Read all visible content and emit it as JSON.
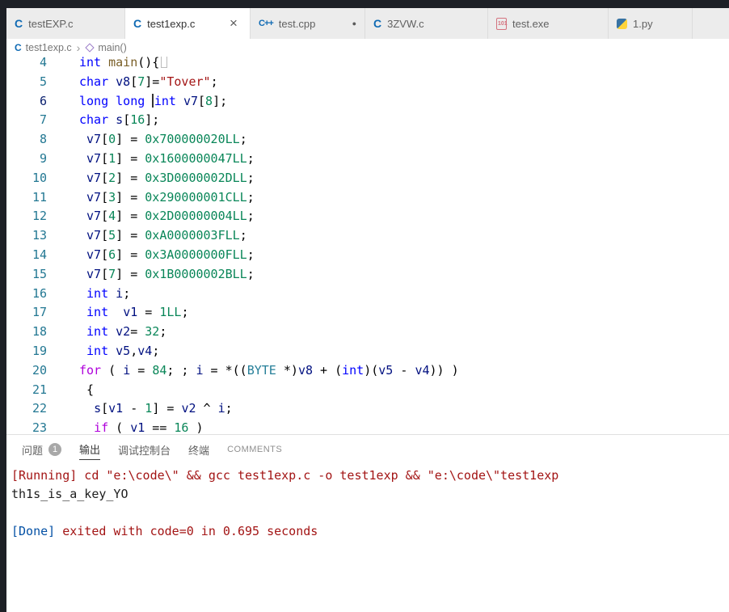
{
  "colors": {
    "keyword": "#0000ff",
    "control": "#af00db",
    "number": "#098658",
    "string": "#a31515",
    "variable": "#001080",
    "type": "#267f99",
    "function": "#795e26",
    "line_number": "#237893",
    "output_red": "#a31515",
    "output_blue": "#0451a5",
    "dark_strip": "#1d2026",
    "tab_inactive_bg": "#ececec",
    "tab_active_bg": "#ffffff"
  },
  "tabs": [
    {
      "label": "testEXP.c",
      "icon": "c",
      "active": false,
      "modified": false,
      "closable": false
    },
    {
      "label": "test1exp.c",
      "icon": "c",
      "active": true,
      "modified": false,
      "closable": true
    },
    {
      "label": "test.cpp",
      "icon": "cpp",
      "active": false,
      "modified": true,
      "closable": false
    },
    {
      "label": "3ZVW.c",
      "icon": "c",
      "active": false,
      "modified": false,
      "closable": false
    },
    {
      "label": "test.exe",
      "icon": "exe",
      "active": false,
      "modified": false,
      "closable": false
    },
    {
      "label": "1.py",
      "icon": "py",
      "active": false,
      "modified": false,
      "closable": false
    }
  ],
  "breadcrumb": {
    "file": "test1exp.c",
    "separator": "›",
    "symbol": "main()"
  },
  "editor": {
    "cursor_line": 6,
    "lines": [
      {
        "num": 4,
        "tokens": [
          [
            "int",
            "kw"
          ],
          [
            " ",
            "pl"
          ],
          [
            "main",
            "fn"
          ],
          [
            "(){",
            "pl"
          ],
          [
            "",
            "box"
          ]
        ]
      },
      {
        "num": 5,
        "tokens": [
          [
            "char",
            "kw"
          ],
          [
            " ",
            "pl"
          ],
          [
            "v8",
            "var"
          ],
          [
            "[",
            "pl"
          ],
          [
            "7",
            "num"
          ],
          [
            "]=",
            "pl"
          ],
          [
            "\"Tover\"",
            "str"
          ],
          [
            ";",
            "pl"
          ]
        ]
      },
      {
        "num": 6,
        "tokens": [
          [
            "long",
            "kw"
          ],
          [
            " ",
            "pl"
          ],
          [
            "long",
            "kw"
          ],
          [
            " ",
            "pl"
          ],
          [
            "",
            "cur"
          ],
          [
            "int",
            "kw"
          ],
          [
            " ",
            "pl"
          ],
          [
            "v7",
            "var"
          ],
          [
            "[",
            "pl"
          ],
          [
            "8",
            "num"
          ],
          [
            "];",
            "pl"
          ]
        ]
      },
      {
        "num": 7,
        "tokens": [
          [
            "char",
            "kw"
          ],
          [
            " ",
            "pl"
          ],
          [
            "s",
            "var"
          ],
          [
            "[",
            "pl"
          ],
          [
            "16",
            "num"
          ],
          [
            "];",
            "pl"
          ]
        ]
      },
      {
        "num": 8,
        "tokens": [
          [
            " ",
            "pl"
          ],
          [
            "v7",
            "var"
          ],
          [
            "[",
            "pl"
          ],
          [
            "0",
            "num"
          ],
          [
            "] = ",
            "pl"
          ],
          [
            "0x700000020LL",
            "num"
          ],
          [
            ";",
            "pl"
          ]
        ]
      },
      {
        "num": 9,
        "tokens": [
          [
            " ",
            "pl"
          ],
          [
            "v7",
            "var"
          ],
          [
            "[",
            "pl"
          ],
          [
            "1",
            "num"
          ],
          [
            "] = ",
            "pl"
          ],
          [
            "0x1600000047LL",
            "num"
          ],
          [
            ";",
            "pl"
          ]
        ]
      },
      {
        "num": 10,
        "tokens": [
          [
            " ",
            "pl"
          ],
          [
            "v7",
            "var"
          ],
          [
            "[",
            "pl"
          ],
          [
            "2",
            "num"
          ],
          [
            "] = ",
            "pl"
          ],
          [
            "0x3D0000002DLL",
            "num"
          ],
          [
            ";",
            "pl"
          ]
        ]
      },
      {
        "num": 11,
        "tokens": [
          [
            " ",
            "pl"
          ],
          [
            "v7",
            "var"
          ],
          [
            "[",
            "pl"
          ],
          [
            "3",
            "num"
          ],
          [
            "] = ",
            "pl"
          ],
          [
            "0x290000001CLL",
            "num"
          ],
          [
            ";",
            "pl"
          ]
        ]
      },
      {
        "num": 12,
        "tokens": [
          [
            " ",
            "pl"
          ],
          [
            "v7",
            "var"
          ],
          [
            "[",
            "pl"
          ],
          [
            "4",
            "num"
          ],
          [
            "] = ",
            "pl"
          ],
          [
            "0x2D00000004LL",
            "num"
          ],
          [
            ";",
            "pl"
          ]
        ]
      },
      {
        "num": 13,
        "tokens": [
          [
            " ",
            "pl"
          ],
          [
            "v7",
            "var"
          ],
          [
            "[",
            "pl"
          ],
          [
            "5",
            "num"
          ],
          [
            "] = ",
            "pl"
          ],
          [
            "0xA0000003FLL",
            "num"
          ],
          [
            ";",
            "pl"
          ]
        ]
      },
      {
        "num": 14,
        "tokens": [
          [
            " ",
            "pl"
          ],
          [
            "v7",
            "var"
          ],
          [
            "[",
            "pl"
          ],
          [
            "6",
            "num"
          ],
          [
            "] = ",
            "pl"
          ],
          [
            "0x3A0000000FLL",
            "num"
          ],
          [
            ";",
            "pl"
          ]
        ]
      },
      {
        "num": 15,
        "tokens": [
          [
            " ",
            "pl"
          ],
          [
            "v7",
            "var"
          ],
          [
            "[",
            "pl"
          ],
          [
            "7",
            "num"
          ],
          [
            "] = ",
            "pl"
          ],
          [
            "0x1B0000002BLL",
            "num"
          ],
          [
            ";",
            "pl"
          ]
        ]
      },
      {
        "num": 16,
        "tokens": [
          [
            " ",
            "pl"
          ],
          [
            "int",
            "kw"
          ],
          [
            " ",
            "pl"
          ],
          [
            "i",
            "var"
          ],
          [
            ";",
            "pl"
          ]
        ]
      },
      {
        "num": 17,
        "tokens": [
          [
            " ",
            "pl"
          ],
          [
            "int",
            "kw"
          ],
          [
            "  ",
            "pl"
          ],
          [
            "v1",
            "var"
          ],
          [
            " = ",
            "pl"
          ],
          [
            "1LL",
            "num"
          ],
          [
            ";",
            "pl"
          ]
        ]
      },
      {
        "num": 18,
        "tokens": [
          [
            " ",
            "pl"
          ],
          [
            "int",
            "kw"
          ],
          [
            " ",
            "pl"
          ],
          [
            "v2",
            "var"
          ],
          [
            "= ",
            "pl"
          ],
          [
            "32",
            "num"
          ],
          [
            ";",
            "pl"
          ]
        ]
      },
      {
        "num": 19,
        "tokens": [
          [
            " ",
            "pl"
          ],
          [
            "int",
            "kw"
          ],
          [
            " ",
            "pl"
          ],
          [
            "v5",
            "var"
          ],
          [
            ",",
            "pl"
          ],
          [
            "v4",
            "var"
          ],
          [
            ";",
            "pl"
          ]
        ]
      },
      {
        "num": 20,
        "tokens": [
          [
            "for",
            "ctrl"
          ],
          [
            " ( ",
            "pl"
          ],
          [
            "i",
            "var"
          ],
          [
            " = ",
            "pl"
          ],
          [
            "84",
            "num"
          ],
          [
            "; ; ",
            "pl"
          ],
          [
            "i",
            "var"
          ],
          [
            " = *((",
            "pl"
          ],
          [
            "BYTE",
            "typ"
          ],
          [
            " *)",
            "pl"
          ],
          [
            "v8",
            "var"
          ],
          [
            " + (",
            "pl"
          ],
          [
            "int",
            "kw"
          ],
          [
            ")(",
            "pl"
          ],
          [
            "v5",
            "var"
          ],
          [
            " - ",
            "pl"
          ],
          [
            "v4",
            "var"
          ],
          [
            ")) )",
            "pl"
          ]
        ]
      },
      {
        "num": 21,
        "tokens": [
          [
            " {",
            "pl"
          ]
        ]
      },
      {
        "num": 22,
        "tokens": [
          [
            "  ",
            "pl"
          ],
          [
            "s",
            "var"
          ],
          [
            "[",
            "pl"
          ],
          [
            "v1",
            "var"
          ],
          [
            " - ",
            "pl"
          ],
          [
            "1",
            "num"
          ],
          [
            "] = ",
            "pl"
          ],
          [
            "v2",
            "var"
          ],
          [
            " ^ ",
            "pl"
          ],
          [
            "i",
            "var"
          ],
          [
            ";",
            "pl"
          ]
        ]
      },
      {
        "num": 23,
        "tokens": [
          [
            "  ",
            "pl"
          ],
          [
            "if",
            "ctrl"
          ],
          [
            " ( ",
            "pl"
          ],
          [
            "v1",
            "var"
          ],
          [
            " == ",
            "pl"
          ],
          [
            "16",
            "num"
          ],
          [
            " )",
            "pl"
          ]
        ]
      }
    ]
  },
  "panel": {
    "tabs": [
      {
        "label": "问题",
        "badge": "1",
        "active": false
      },
      {
        "label": "输出",
        "active": true
      },
      {
        "label": "调试控制台",
        "active": false
      },
      {
        "label": "终端",
        "active": false
      },
      {
        "label": "COMMENTS",
        "active": false
      }
    ]
  },
  "output": {
    "lines": [
      {
        "spans": [
          [
            "[Running] cd \"e:\\code\\\" && gcc test1exp.c -o test1exp && \"e:\\code\\\"test1exp",
            "red"
          ]
        ]
      },
      {
        "spans": [
          [
            "th1s_is_a_key_YO",
            "plain"
          ]
        ]
      },
      {
        "spans": []
      },
      {
        "spans": [
          [
            "[Done]",
            "blue"
          ],
          [
            " exited with code=0 in 0.695 seconds",
            "red"
          ]
        ]
      }
    ]
  }
}
